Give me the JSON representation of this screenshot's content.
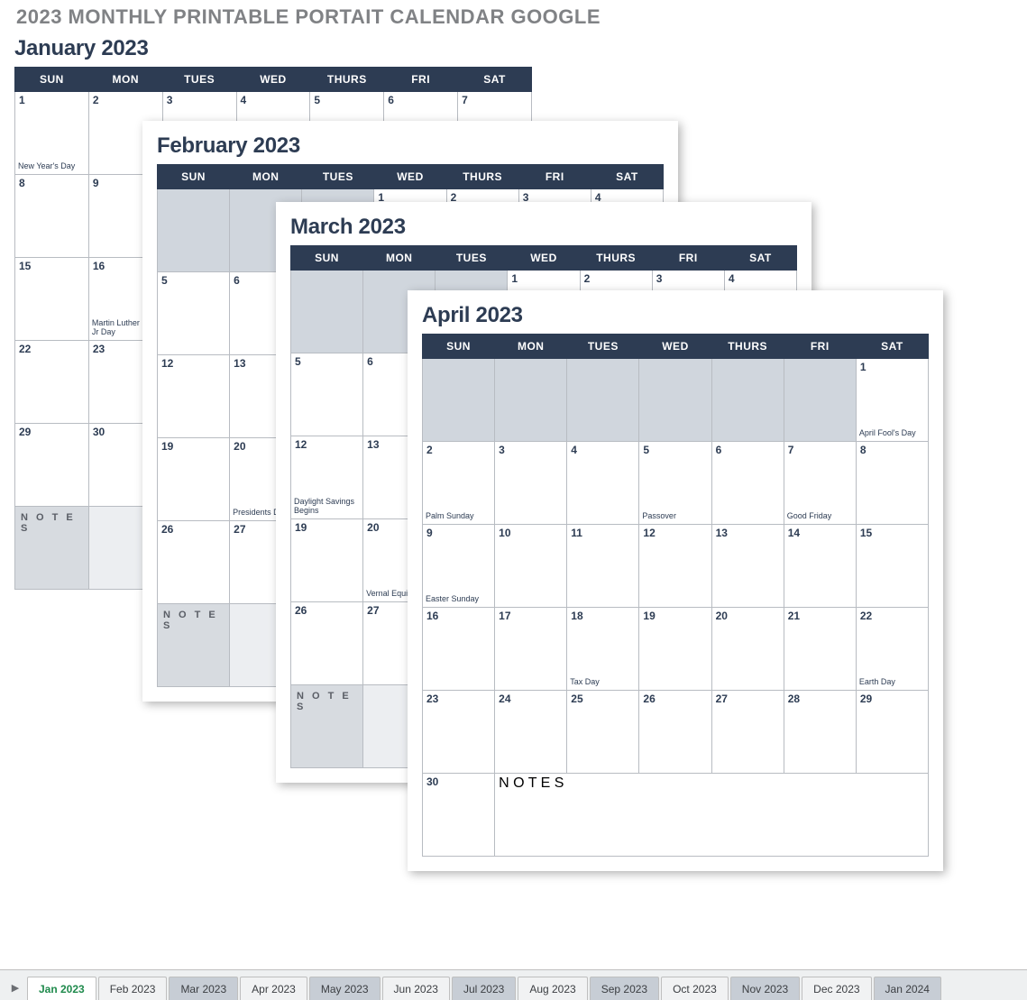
{
  "title": "2023 MONTHLY PRINTABLE PORTAIT CALENDAR GOOGLE",
  "dow": [
    "SUN",
    "MON",
    "TUES",
    "WED",
    "THURS",
    "FRI",
    "SAT"
  ],
  "notes_label": "N O T E S",
  "months": {
    "jan": {
      "title": "January 2023",
      "lead_empty": 0,
      "days": 31,
      "events": {
        "1": "New Year's Day",
        "16": "Martin Luther King Jr Day"
      }
    },
    "feb": {
      "title": "February 2023",
      "lead_empty": 3,
      "days": 28,
      "events": {
        "20": "Presidents Day"
      }
    },
    "mar": {
      "title": "March 2023",
      "lead_empty": 3,
      "days": 31,
      "events": {
        "12": "Daylight Savings Begins",
        "20": "Vernal Equinox"
      }
    },
    "apr": {
      "title": "April 2023",
      "lead_empty": 6,
      "days": 30,
      "events": {
        "1": "April Fool's Day",
        "2": "Palm Sunday",
        "5": "Passover",
        "7": "Good Friday",
        "9": "Easter Sunday",
        "18": "Tax Day",
        "22": "Earth Day"
      }
    }
  },
  "tabs": [
    {
      "label": "Jan 2023",
      "variant": "active"
    },
    {
      "label": "Feb 2023",
      "variant": "light"
    },
    {
      "label": "Mar 2023",
      "variant": "alt"
    },
    {
      "label": "Apr 2023",
      "variant": "light"
    },
    {
      "label": "May 2023",
      "variant": "alt"
    },
    {
      "label": "Jun 2023",
      "variant": "light"
    },
    {
      "label": "Jul 2023",
      "variant": "alt"
    },
    {
      "label": "Aug 2023",
      "variant": "light"
    },
    {
      "label": "Sep 2023",
      "variant": "alt"
    },
    {
      "label": "Oct 2023",
      "variant": "light"
    },
    {
      "label": "Nov 2023",
      "variant": "alt"
    },
    {
      "label": "Dec 2023",
      "variant": "light"
    },
    {
      "label": "Jan 2024",
      "variant": "alt"
    }
  ]
}
